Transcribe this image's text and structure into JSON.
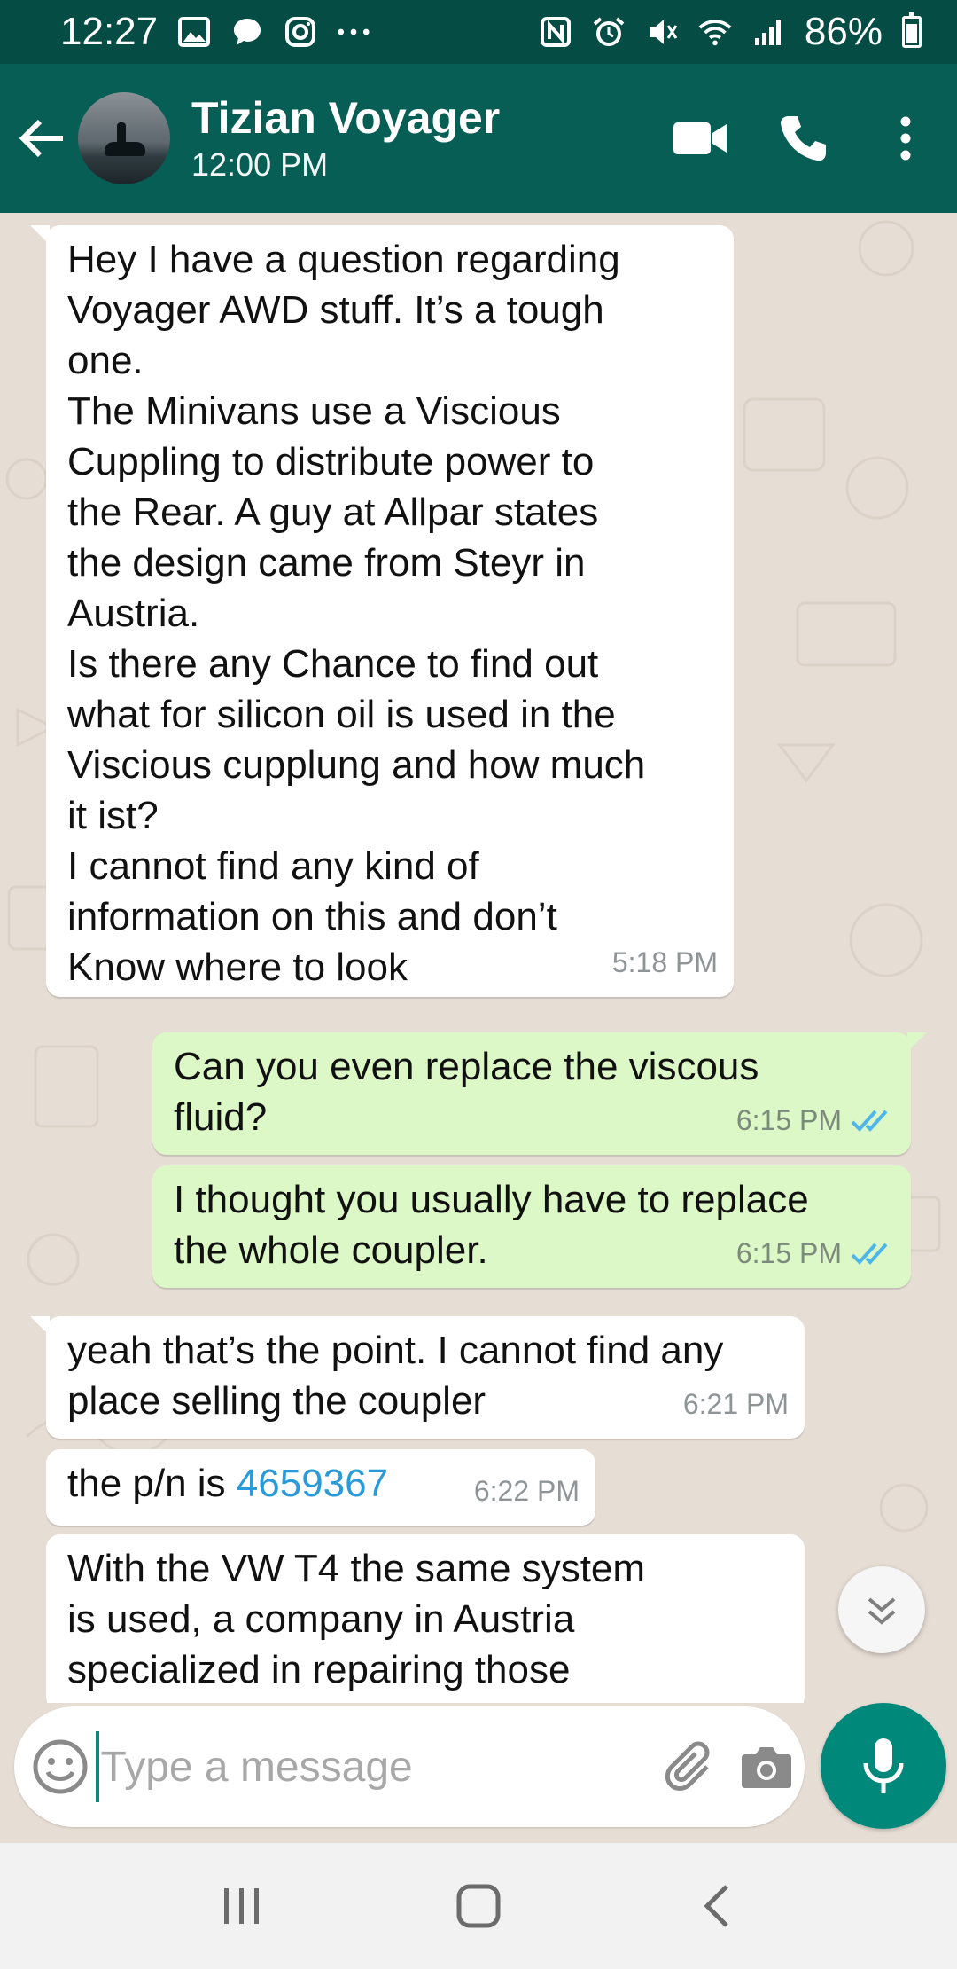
{
  "status_bar": {
    "time": "12:27",
    "battery": "86%",
    "icons": [
      "gallery-icon",
      "chat-icon",
      "instagram-icon",
      "more-icon",
      "nfc-icon",
      "alarm-icon",
      "mute-icon",
      "wifi-icon",
      "signal-icon",
      "battery-icon"
    ]
  },
  "header": {
    "name": "Tizian Voyager",
    "status": "12:00 PM",
    "color": "#075e54"
  },
  "messages": [
    {
      "dir": "in",
      "text": "Hey I have a question regarding\nVoyager AWD stuff. It’s a tough\none.\nThe Minivans use a Viscious\nCuppling to distribute power to\nthe Rear. A guy at Allpar states\nthe design came from Steyr in\nAustria.\nIs there any Chance to find out\nwhat for silicon oil is used in the\nViscious cupplung and how much\nit ist?\nI cannot find any kind of\ninformation on this and don’t\nKnow where to look",
      "time": "5:18 PM"
    },
    {
      "dir": "out",
      "text": "Can you even replace the viscous\nfluid?",
      "time": "6:15 PM",
      "read": true
    },
    {
      "dir": "out",
      "text": "I thought you usually have to replace\nthe whole coupler.",
      "time": "6:15 PM",
      "read": true
    },
    {
      "dir": "in",
      "text": "yeah that’s the point. I cannot find any\nplace selling the coupler",
      "time": "6:21 PM"
    },
    {
      "dir": "in",
      "text_prefix": "the p/n is ",
      "link": "4659367",
      "time": "6:22 PM"
    },
    {
      "dir": "in",
      "text": "With the VW T4 the same system\nis used, a company in Austria\nspecialized in repairing those"
    }
  ],
  "input": {
    "placeholder": "Type a message",
    "value": ""
  },
  "colors": {
    "chat_bg": "#e6ddd4",
    "out_bubble": "#dcf8c6",
    "accent": "#00897b",
    "link": "#2a9bd8",
    "read_ticks": "#4fb6ec"
  }
}
